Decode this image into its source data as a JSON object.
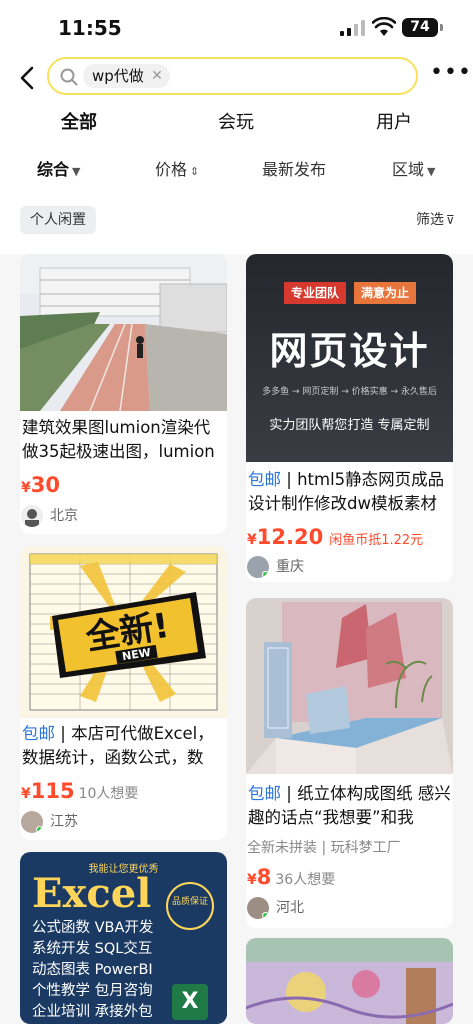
{
  "status": {
    "time": "11:55",
    "battery": "74"
  },
  "search": {
    "query": "wp代做"
  },
  "tabs": [
    {
      "label": "全部"
    },
    {
      "label": "会玩"
    },
    {
      "label": "用户"
    }
  ],
  "filters": [
    {
      "label": "综合"
    },
    {
      "label": "价格"
    },
    {
      "label": "最新发布"
    },
    {
      "label": "区域"
    }
  ],
  "chip": {
    "personal": "个人闲置",
    "screen": "筛选"
  },
  "items": [
    {
      "title": "建筑效果图lumion渲染代做35起极速出图，lumion",
      "price": "30",
      "location": "北京"
    },
    {
      "tag": "包邮",
      "title": "html5静态网页成品设计制作修改dw模板素材",
      "price": "12.20",
      "coin": "闲鱼币抵1.22元",
      "location": "重庆",
      "poster": {
        "badge1": "专业团队",
        "badge2": "满意为止",
        "heading": "网页设计",
        "small": "多多鱼 → 网页定制 → 价格实惠 → 永久售后",
        "slogan": "实力团队帮您打造 专属定制"
      }
    },
    {
      "tag": "包邮",
      "title": "本店可代做Excel，数据统计，函数公式，数",
      "price": "115",
      "want": "10人想要",
      "location": "江苏",
      "sticker": {
        "main": "全新!",
        "sub": "NEW"
      }
    },
    {
      "tag": "包邮",
      "title": "纸立体构成图纸 感兴趣的话点“我想要”和我",
      "sub": "全新未拼装 | 玩科梦工厂",
      "price": "8",
      "want": "36人想要",
      "location": "河北"
    },
    {
      "poster": {
        "head": "我能让您更优秀",
        "word": "Excel",
        "lines": "公式函数 VBA开发\n系统开发 SQL交互\n动态图表 PowerBI\n个性教学 包月咨询\n企业培训 承接外包",
        "seal": "品质保证",
        "xl": "X"
      }
    }
  ],
  "colors": {
    "accent": "#f7e15a",
    "price": "#ff4a2c",
    "tag": "#2a76d8"
  }
}
